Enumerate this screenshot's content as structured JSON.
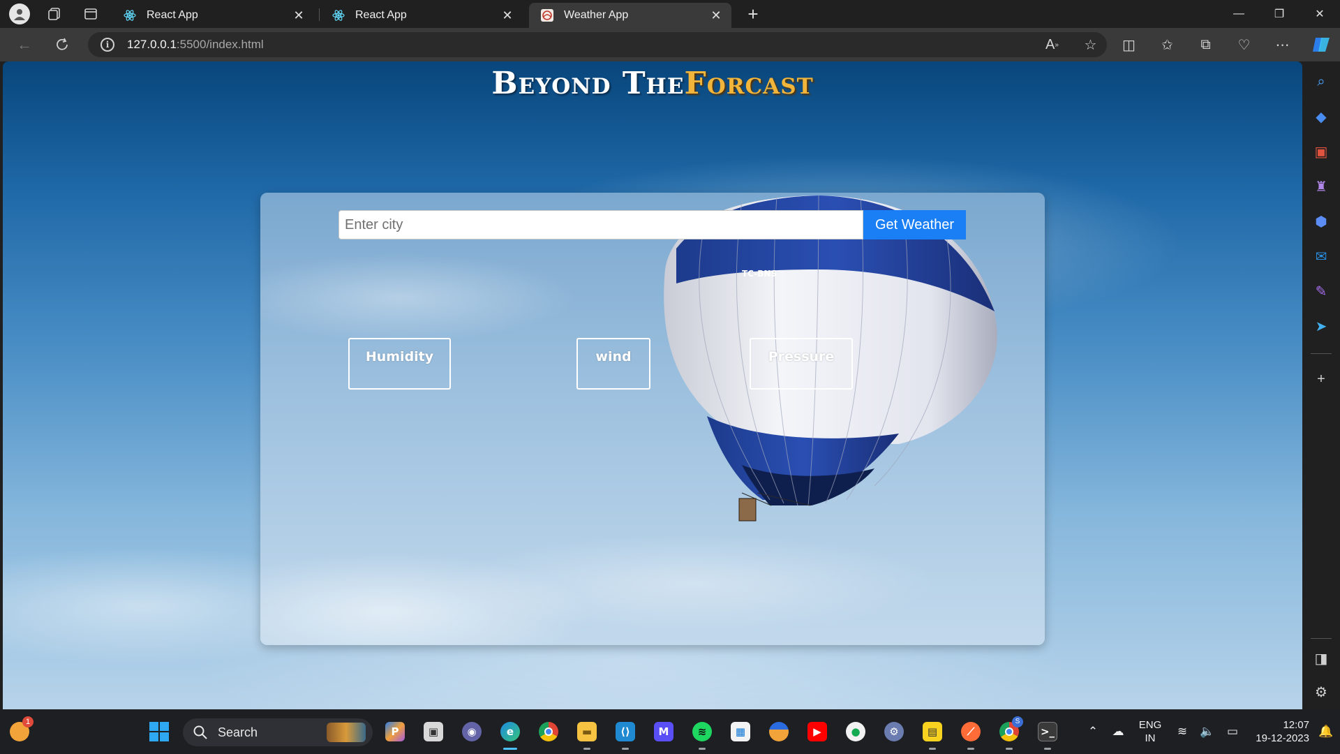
{
  "browser": {
    "tabs": [
      {
        "title": "React App",
        "icon": "react-icon",
        "active": false
      },
      {
        "title": "React App",
        "icon": "react-icon",
        "active": false
      },
      {
        "title": "Weather App",
        "icon": "weather-favicon",
        "active": true
      }
    ],
    "address": {
      "host": "127.0.0.1",
      "path": ":5500/index.html"
    },
    "toolbar_icons": [
      "read-aloud-icon",
      "favorite-star-icon",
      "split-screen-icon",
      "favorites-icon",
      "collections-icon",
      "browser-essentials-icon",
      "more-icon",
      "copilot-icon"
    ]
  },
  "page": {
    "title_part1": "Beyond The",
    "title_part2": "Forcast",
    "search": {
      "placeholder": "Enter city",
      "value": "",
      "button_label": "Get Weather"
    },
    "metrics": {
      "humidity": "Humidity",
      "wind": "wind",
      "pressure": "Pressure"
    },
    "balloon_registration": "TC-BNS",
    "colors": {
      "button": "#1a7ff5",
      "title_accent": "#f2b53b"
    }
  },
  "taskbar": {
    "search_label": "Search",
    "widget_badge": "1",
    "chrome_badge": "S",
    "language": {
      "line1": "ENG",
      "line2": "IN"
    },
    "clock": {
      "time": "12:07",
      "date": "19-12-2023"
    }
  }
}
